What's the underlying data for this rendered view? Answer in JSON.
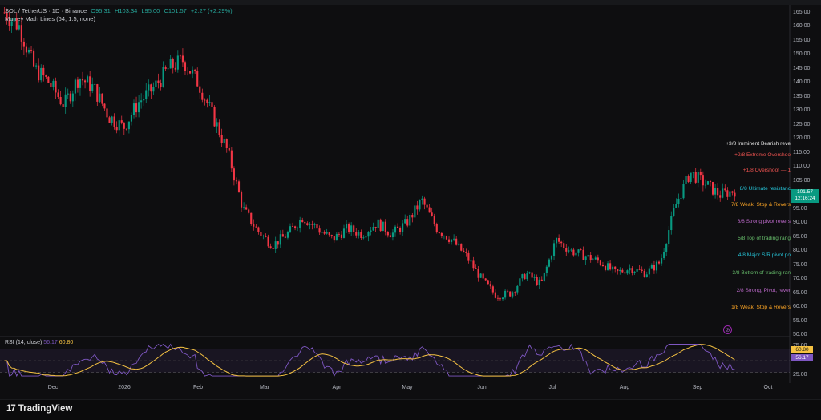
{
  "legend": {
    "symbol": "SOL / TetherUS · 1D · Binance",
    "open": "O95.31",
    "high": "H103.34",
    "low": "L95.00",
    "close": "C101.57",
    "change": "+2.27 (+2.29%)",
    "indicator": "Murrey Math Lines (64, 1.5, none)"
  },
  "price_axis": {
    "ticks": [
      "165.00",
      "160.00",
      "155.00",
      "150.00",
      "145.00",
      "140.00",
      "135.00",
      "130.00",
      "125.00",
      "120.00",
      "115.00",
      "110.00",
      "105.00",
      "100.00",
      "95.00",
      "90.00",
      "85.00",
      "80.00",
      "75.00",
      "70.00",
      "65.00",
      "60.00",
      "55.00",
      "50.00"
    ],
    "last_price": "101.57",
    "countdown": "12:16:24"
  },
  "murrey_lines": [
    {
      "text": "+3/8 Imminent Bearish reve",
      "color": "#e6e6e6",
      "price": 118
    },
    {
      "text": "+2/8 Extreme Overshoo",
      "color": "#ef5350",
      "price": 114
    },
    {
      "text": "+1/8 Overshoot — 1",
      "color": "#ef5350",
      "price": 108.5
    },
    {
      "text": "8/8 Ultimate resistanc",
      "color": "#26c6da",
      "price": 102
    },
    {
      "text": "7/8 Weak, Stop & Revers",
      "color": "#ffa726",
      "price": 96.3
    },
    {
      "text": "6/8 Strong pivot revers",
      "color": "#ba68c8",
      "price": 90.2
    },
    {
      "text": "5/8 Top of trading rang",
      "color": "#66bb6a",
      "price": 84.2
    },
    {
      "text": "4/8 Major S/R pivot po",
      "color": "#26c6da",
      "price": 78.3
    },
    {
      "text": "3/8 Bottom of trading ran",
      "color": "#66bb6a",
      "price": 72.0
    },
    {
      "text": "2/8 Strong, Pivot, rever",
      "color": "#ba68c8",
      "price": 65.8
    },
    {
      "text": "1/8 Weak, Stop & Revers",
      "color": "#ffa726",
      "price": 59.8
    }
  ],
  "rsi": {
    "label": "RSI (14, close)",
    "value": "56.17",
    "ma_value": "60.80",
    "axis_ticks": [
      "75.00",
      "50.00",
      "25.00"
    ]
  },
  "x_axis": [
    "Dec",
    "2026",
    "Feb",
    "Mar",
    "Apr",
    "May",
    "Jun",
    "Jul",
    "Aug",
    "Sep",
    "Oct"
  ],
  "brand": "TradingView",
  "colors": {
    "up": "#089981",
    "down": "#f23645",
    "rsi_line": "#7e57c2",
    "rsi_ma": "#f5c242"
  },
  "chart_data": {
    "type": "candlestick",
    "title": "SOL / TetherUS · 1D · Binance",
    "ylim": [
      50,
      166
    ],
    "x_categories": [
      "Dec",
      "2026",
      "Feb",
      "Mar",
      "Apr",
      "May",
      "Jun",
      "Jul",
      "Aug",
      "Sep",
      "Oct"
    ],
    "close_path": [
      165,
      160,
      145,
      140,
      132,
      142,
      138,
      128,
      124,
      133,
      138,
      145,
      148,
      140,
      128,
      115,
      95,
      87,
      82,
      86,
      92,
      88,
      84,
      88,
      86,
      90,
      86,
      90,
      98,
      88,
      84,
      78,
      70,
      64,
      65,
      72,
      68,
      84,
      80,
      78,
      76,
      72,
      74,
      72,
      76,
      96,
      108,
      104,
      100,
      101.57
    ],
    "last_close": 101.57,
    "rsi_range": [
      25,
      75
    ]
  }
}
